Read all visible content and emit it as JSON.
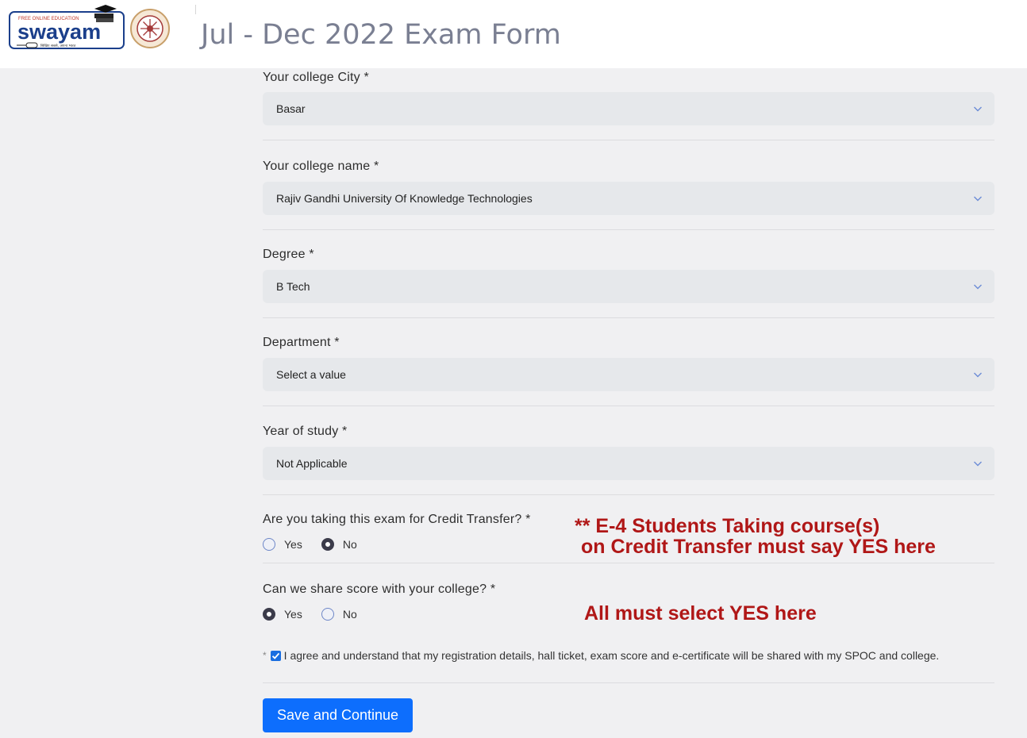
{
  "header": {
    "title": "Jul - Dec 2022 Exam Form",
    "logo_top_text": "FREE ONLINE EDUCATION",
    "logo_name": "swayam",
    "logo_tagline": "सिखिए सबसे, अपना भारत"
  },
  "form": {
    "city": {
      "label": "Your college City *",
      "value": "Basar"
    },
    "college": {
      "label": "Your college name *",
      "value": "Rajiv Gandhi University Of Knowledge Technologies"
    },
    "degree": {
      "label": "Degree *",
      "value": "B Tech"
    },
    "department": {
      "label": "Department *",
      "value": "Select a value"
    },
    "year": {
      "label": "Year of study *",
      "value": "Not Applicable"
    },
    "credit_transfer": {
      "label": "Are you taking this exam for Credit Transfer? *",
      "yes_label": "Yes",
      "no_label": "No",
      "selected": "No"
    },
    "share_score": {
      "label": "Can we share score with your college? *",
      "yes_label": "Yes",
      "no_label": "No",
      "selected": "Yes"
    },
    "agree": {
      "asterisk": "*",
      "text": "I agree and understand that my registration details, hall ticket, exam score and e-certificate will be shared with my SPOC and college.",
      "checked": true
    },
    "submit_label": "Save and Continue"
  },
  "annotations": {
    "credit_line1": "** E-4 Students Taking course(s)",
    "credit_line2": "on Credit Transfer must say YES here",
    "share_note": "All must select YES here",
    "color": "#b01717"
  },
  "colors": {
    "accent": "#0d6efd",
    "select_bg": "#e6e8eb",
    "page_bg": "#f0f0f2"
  }
}
